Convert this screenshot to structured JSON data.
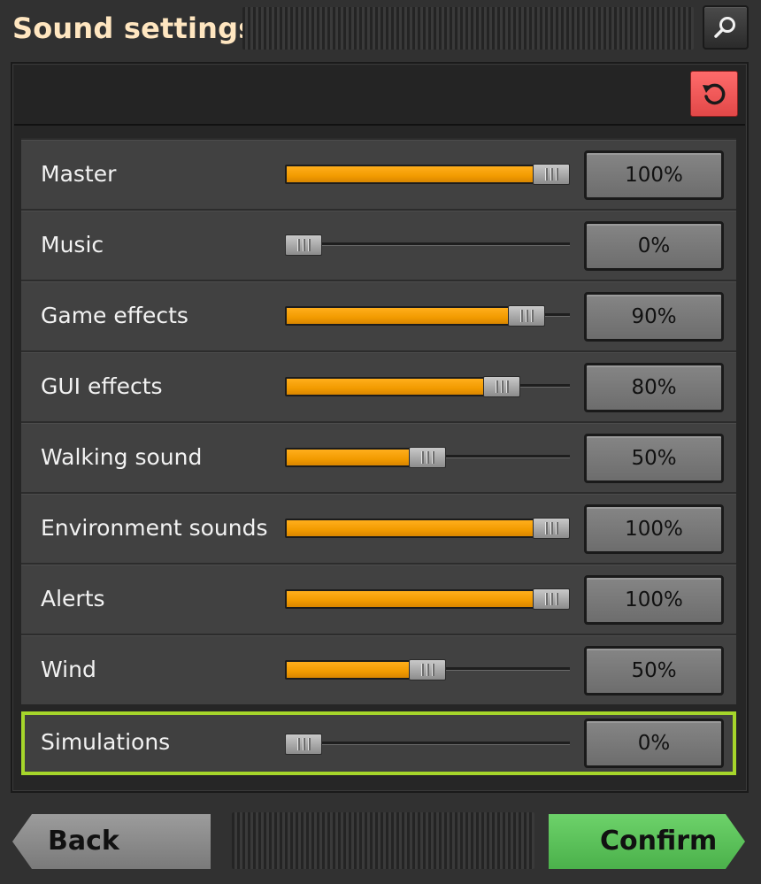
{
  "window": {
    "title": "Sound settings"
  },
  "header": {
    "search_icon": "magnifier-icon",
    "reset_icon": "reset-arrow-icon",
    "reset_color": "#ff5c5c"
  },
  "settings": [
    {
      "label": "Master",
      "value_text": "100%",
      "value": 1.0
    },
    {
      "label": "Music",
      "value_text": "0%",
      "value": 0.0
    },
    {
      "label": "Game effects",
      "value_text": "90%",
      "value": 0.9
    },
    {
      "label": "GUI effects",
      "value_text": "80%",
      "value": 0.8
    },
    {
      "label": "Walking sound",
      "value_text": "50%",
      "value": 0.5
    },
    {
      "label": "Environment sounds",
      "value_text": "100%",
      "value": 1.0
    },
    {
      "label": "Alerts",
      "value_text": "100%",
      "value": 1.0
    },
    {
      "label": "Wind",
      "value_text": "50%",
      "value": 0.5
    },
    {
      "label": "Simulations",
      "value_text": "0%",
      "value": 0.0,
      "focused": true
    }
  ],
  "footer": {
    "back_label": "Back",
    "confirm_label": "Confirm",
    "confirm_color": "#5cc45a"
  },
  "colors": {
    "slider_fill": "#f29b00",
    "focus_outline": "#a6d62b",
    "title_text": "#ffe6c0"
  }
}
